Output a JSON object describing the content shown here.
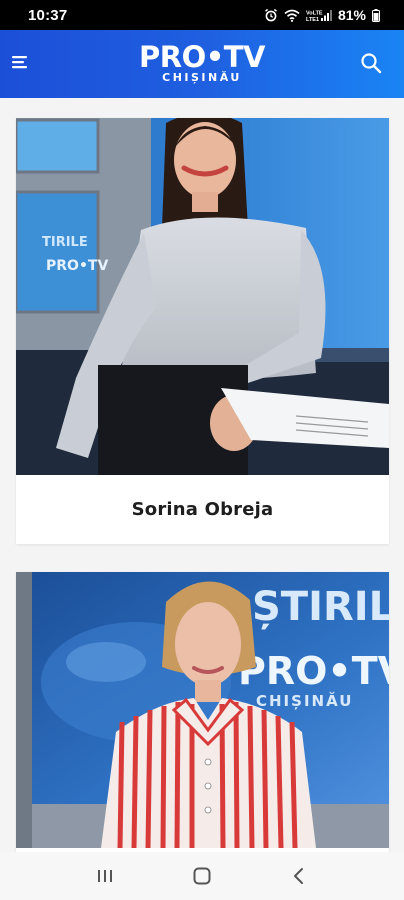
{
  "status_bar": {
    "time": "10:37",
    "network_label": "VoLTE1 LTE1",
    "battery": "81%"
  },
  "header": {
    "logo_main": "PRO•TV",
    "logo_sub": "CHIȘINĂU",
    "menu_icon": "hamburger-menu-icon",
    "search_icon": "search-icon"
  },
  "presenters": [
    {
      "name": "Sorina Obreja"
    },
    {
      "name": ""
    }
  ],
  "photo_text": {
    "monitor_small": "TIRILE",
    "monitor_logo": "PRO•TV",
    "backdrop_1": "ȘTIRILE",
    "backdrop_2": "PRO•TV",
    "backdrop_3": "CHIȘINĂU"
  },
  "nav_bar": {
    "recents_icon": "recent-apps-icon",
    "home_icon": "home-icon",
    "back_icon": "back-icon"
  },
  "colors": {
    "header_start": "#1c4fd8",
    "header_end": "#1a84f5",
    "card_background": "#ffffff",
    "page_background": "#f4f4f4"
  }
}
